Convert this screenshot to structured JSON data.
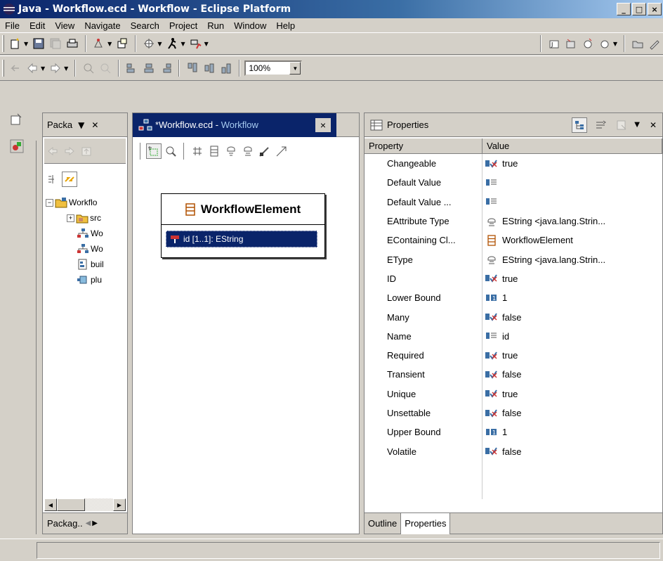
{
  "window": {
    "title": "Java - Workflow.ecd - Workflow - Eclipse Platform",
    "controls": {
      "minimize": "_",
      "maximize": "□",
      "close": "×"
    }
  },
  "menu": [
    "File",
    "Edit",
    "View",
    "Navigate",
    "Search",
    "Project",
    "Run",
    "Window",
    "Help"
  ],
  "toolbar2": {
    "zoom_value": "100%"
  },
  "package_explorer": {
    "tab_label": "Packa",
    "bottom_tab_label": "Packag..",
    "tree": [
      {
        "label": "Workflo",
        "level": 0,
        "expander": "−",
        "icon": "project-icon"
      },
      {
        "label": "src",
        "level": 1,
        "expander": "+",
        "icon": "source-folder-icon"
      },
      {
        "label": "Wo",
        "level": 2,
        "expander": "",
        "icon": "diagram-file-icon"
      },
      {
        "label": "Wo",
        "level": 2,
        "expander": "",
        "icon": "diagram-file-icon"
      },
      {
        "label": "buil",
        "level": 2,
        "expander": "",
        "icon": "properties-file-icon"
      },
      {
        "label": "plu",
        "level": 2,
        "expander": "",
        "icon": "plugin-file-icon"
      }
    ]
  },
  "editor": {
    "tab_label_main": "*Workflow.ecd - ",
    "tab_label_faded": "Workflow",
    "close_label": "×",
    "class_box": {
      "name": "WorkflowElement",
      "attribute": "id [1..1]: EString"
    }
  },
  "properties": {
    "tab_label": "Properties",
    "columns": {
      "property": "Property",
      "value": "Value"
    },
    "rows": [
      {
        "property": "Changeable",
        "value": "true",
        "icon": "boolean-icon"
      },
      {
        "property": "Default Value",
        "value": "",
        "icon": "text-icon"
      },
      {
        "property": "Default Value ...",
        "value": "",
        "icon": "text-icon"
      },
      {
        "property": "EAttribute Type",
        "value": "EString <java.lang.Strin...",
        "icon": "datatype-icon"
      },
      {
        "property": "EContaining Cl...",
        "value": "WorkflowElement",
        "icon": "class-icon"
      },
      {
        "property": "EType",
        "value": "EString <java.lang.Strin...",
        "icon": "datatype-icon"
      },
      {
        "property": "ID",
        "value": "true",
        "icon": "boolean-icon"
      },
      {
        "property": "Lower Bound",
        "value": "1",
        "icon": "integer-icon"
      },
      {
        "property": "Many",
        "value": "false",
        "icon": "boolean-icon"
      },
      {
        "property": "Name",
        "value": "id",
        "icon": "text-icon"
      },
      {
        "property": "Required",
        "value": "true",
        "icon": "boolean-icon"
      },
      {
        "property": "Transient",
        "value": "false",
        "icon": "boolean-icon"
      },
      {
        "property": "Unique",
        "value": "true",
        "icon": "boolean-icon"
      },
      {
        "property": "Unsettable",
        "value": "false",
        "icon": "boolean-icon"
      },
      {
        "property": "Upper Bound",
        "value": "1",
        "icon": "integer-icon"
      },
      {
        "property": "Volatile",
        "value": "false",
        "icon": "boolean-icon"
      }
    ],
    "bottom_tabs": [
      "Outline",
      "Properties"
    ]
  }
}
